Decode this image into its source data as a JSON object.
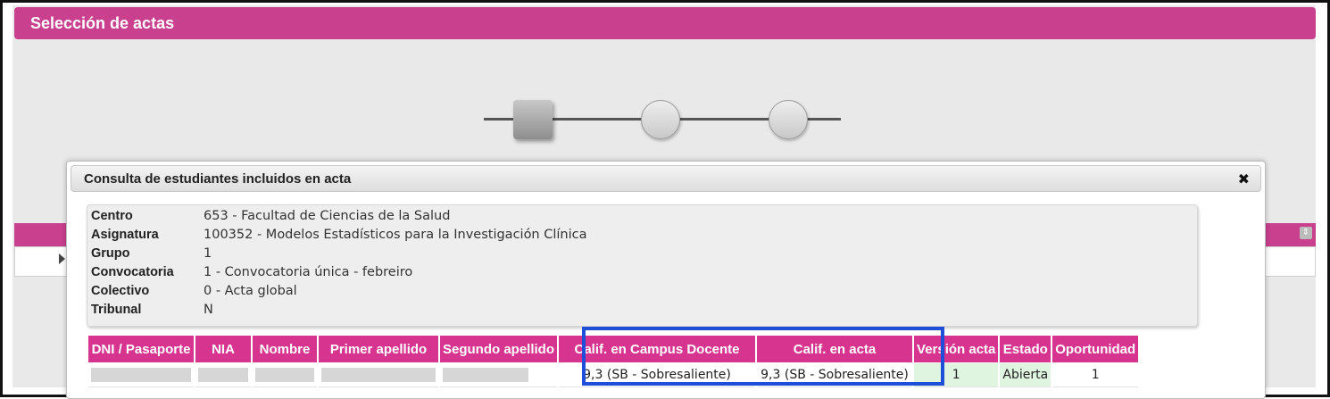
{
  "header": {
    "title": "Selección de actas"
  },
  "modal": {
    "title": "Consulta de estudiantes incluidos en acta",
    "close_label": "✖",
    "info": [
      {
        "label": "Centro",
        "value": "653 - Facultad de Ciencias de la Salud"
      },
      {
        "label": "Asignatura",
        "value": "100352 - Modelos Estadísticos para la Investigación Clínica"
      },
      {
        "label": "Grupo",
        "value": "1"
      },
      {
        "label": "Convocatoria",
        "value": "1 - Convocatoria única - febreiro"
      },
      {
        "label": "Colectivo",
        "value": "0 - Acta global"
      },
      {
        "label": "Tribunal",
        "value": "N"
      }
    ],
    "table": {
      "columns": [
        "DNI / Pasaporte",
        "NIA",
        "Nombre",
        "Primer apellido",
        "Segundo apellido",
        "Calif. en Campus Docente",
        "Calif. en acta",
        "Versión acta",
        "Estado",
        "Oportunidad"
      ],
      "rows": [
        {
          "dni": "",
          "nia": "",
          "nombre": "",
          "primer_apellido": "",
          "segundo_apellido": "",
          "calif_campus": "9,3 (SB - Sobresaliente)",
          "calif_acta": "9,3 (SB - Sobresaliente)",
          "version_acta": "1",
          "estado": "Abierta",
          "oportunidad": "1"
        }
      ]
    }
  },
  "colors": {
    "brand": "#c9408e",
    "header_cell": "#d6348f",
    "highlight": "#1f4fd8",
    "green_cell": "#dff5df"
  },
  "icons": {
    "close": "close-icon",
    "stepper_active": "step-square-icon",
    "stepper_pending": "step-circle-icon"
  }
}
